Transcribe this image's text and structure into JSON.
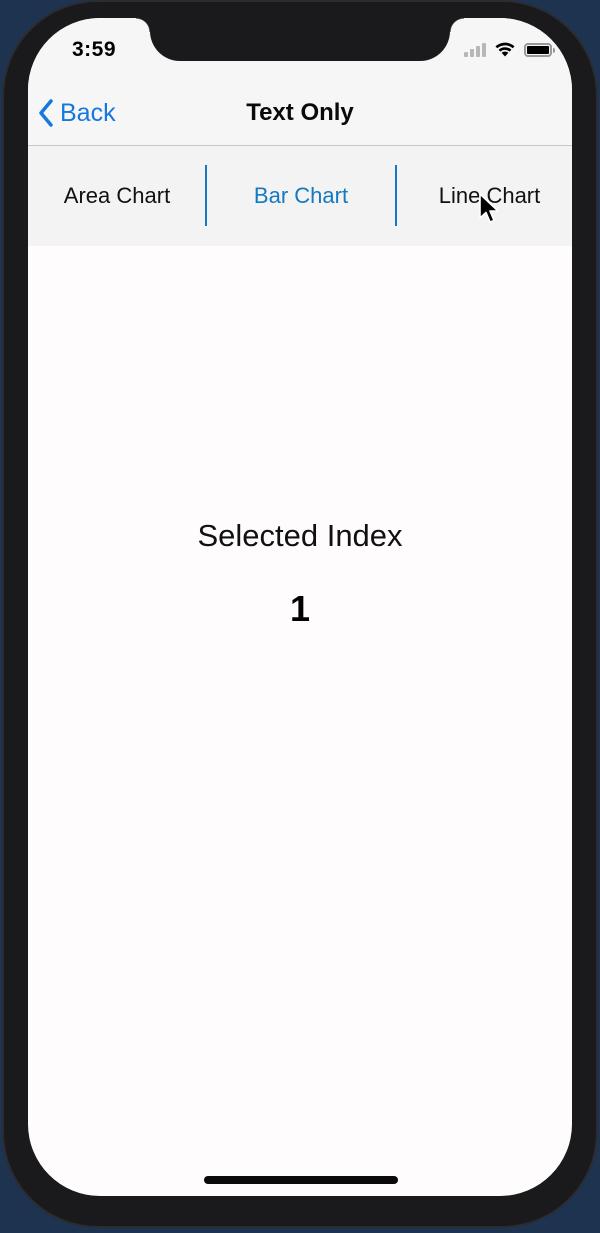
{
  "status_bar": {
    "time": "3:59",
    "icons": [
      "cellular-signal-icon",
      "wifi-icon",
      "battery-icon"
    ]
  },
  "navbar": {
    "back_label": "Back",
    "title": "Text Only"
  },
  "segmented_control": {
    "selected_index": 1,
    "segments": [
      {
        "label": "Area Chart"
      },
      {
        "label": "Bar Chart"
      },
      {
        "label": "Line Chart"
      }
    ]
  },
  "content": {
    "label": "Selected Index",
    "value": "1"
  },
  "colors": {
    "accent": "#1677dd",
    "segment_accent": "#1678c0",
    "bar_background": "#f3f3f4",
    "screen_background": "#fefcfd"
  }
}
